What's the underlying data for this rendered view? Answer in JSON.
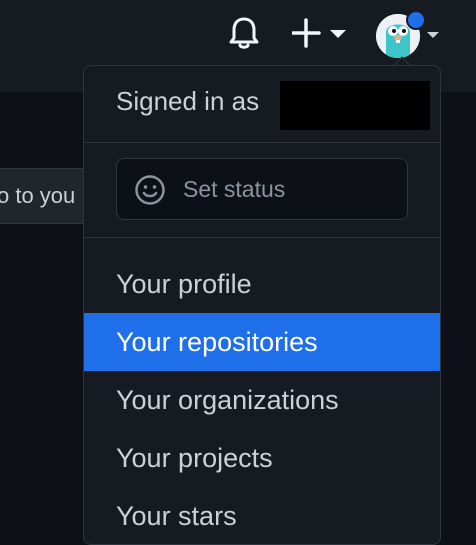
{
  "header": {
    "notifications_icon": "bell-icon",
    "create_icon": "plus-icon",
    "create_caret_icon": "caret-down-icon",
    "avatar_caret_icon": "caret-down-icon"
  },
  "background": {
    "partial_button_text": "o to you"
  },
  "dropdown": {
    "signed_in_label": "Signed in as",
    "status": {
      "icon": "smiley-icon",
      "label": "Set status"
    },
    "items": [
      {
        "label": "Your profile",
        "active": false
      },
      {
        "label": "Your repositories",
        "active": true
      },
      {
        "label": "Your organizations",
        "active": false
      },
      {
        "label": "Your projects",
        "active": false
      },
      {
        "label": "Your stars",
        "active": false
      }
    ]
  },
  "colors": {
    "accent": "#1f6feb",
    "page_bg": "#0d1117",
    "panel_bg": "#161b22",
    "border": "#30363d",
    "text": "#c9d1d9"
  }
}
